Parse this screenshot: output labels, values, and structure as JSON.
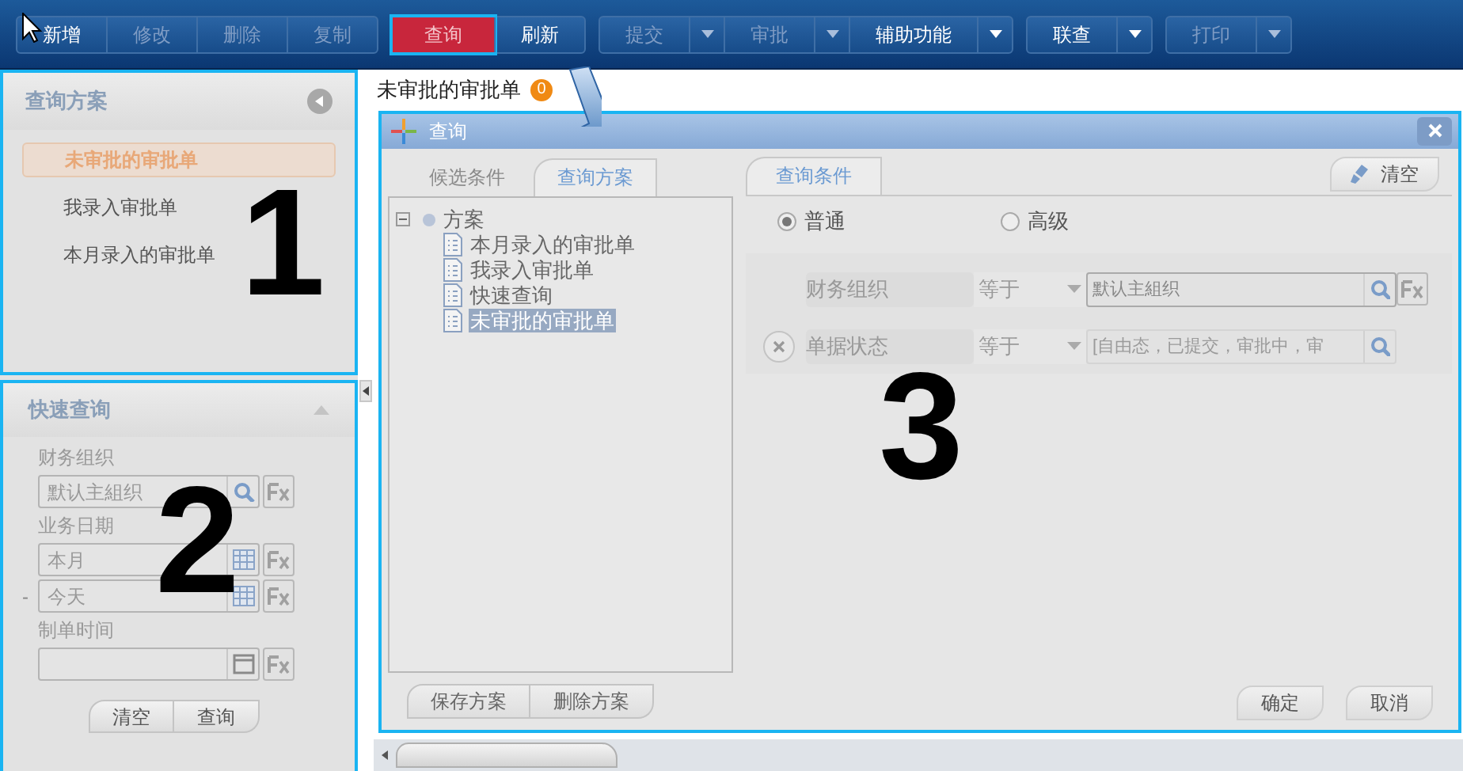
{
  "toolbar": {
    "groups": [
      {
        "buttons": [
          {
            "label": "新增",
            "enabled": true,
            "selected": false,
            "dropdown": false
          },
          {
            "label": "修改",
            "enabled": false,
            "selected": false,
            "dropdown": false
          },
          {
            "label": "删除",
            "enabled": false,
            "selected": false,
            "dropdown": false
          },
          {
            "label": "复制",
            "enabled": false,
            "selected": false,
            "dropdown": false
          }
        ]
      },
      {
        "buttons": [
          {
            "label": "查询",
            "enabled": true,
            "selected": true,
            "dropdown": false
          },
          {
            "label": "刷新",
            "enabled": true,
            "selected": false,
            "dropdown": false
          }
        ]
      },
      {
        "buttons": [
          {
            "label": "提交",
            "enabled": false,
            "selected": false,
            "dropdown": true
          },
          {
            "label": "审批",
            "enabled": false,
            "selected": false,
            "dropdown": true
          },
          {
            "label": "辅助功能",
            "enabled": true,
            "selected": false,
            "dropdown": true
          }
        ]
      },
      {
        "buttons": [
          {
            "label": "联查",
            "enabled": true,
            "selected": false,
            "dropdown": true
          }
        ]
      },
      {
        "buttons": [
          {
            "label": "打印",
            "enabled": false,
            "selected": false,
            "dropdown": true
          }
        ]
      }
    ]
  },
  "scheme_panel": {
    "title": "查询方案",
    "items": [
      {
        "label": "未审批的审批单",
        "selected": true
      },
      {
        "label": "我录入审批单",
        "selected": false
      },
      {
        "label": "本月录入的审批单",
        "selected": false
      }
    ]
  },
  "quick_query": {
    "title": "快速查询",
    "fields": [
      {
        "label": "财务组织",
        "value": "默认主組织",
        "kind": "search"
      },
      {
        "label": "业务日期",
        "value": "本月",
        "kind": "calendar"
      },
      {
        "prefix": "-",
        "value": "今天",
        "kind": "calendar"
      },
      {
        "label": "制单时间",
        "kind": "time"
      }
    ],
    "buttons": [
      "清空",
      "查询"
    ]
  },
  "document_tab": {
    "label": "未审批的审批单",
    "badge": "0"
  },
  "dialog": {
    "title": "查询",
    "left_tabs": [
      {
        "label": "候选条件",
        "selected": false
      },
      {
        "label": "查询方案",
        "selected": true
      }
    ],
    "tree": [
      {
        "label": "方案",
        "expanded": true,
        "selected": false,
        "children": [
          {
            "label": "本月录入的审批单",
            "selected": false
          },
          {
            "label": "我录入审批单",
            "selected": false
          },
          {
            "label": "快速查询",
            "selected": false
          },
          {
            "label": "未审批的审批单",
            "selected": true
          }
        ]
      }
    ],
    "left_buttons": [
      "保存方案",
      "删除方案"
    ],
    "right_tab": "查询条件",
    "clear_button": "清空",
    "modes": [
      {
        "label": "普通",
        "selected": true
      },
      {
        "label": "高级",
        "selected": false
      }
    ],
    "conditions": [
      {
        "field": "财务组织",
        "operator": "等于",
        "value": "默认主組织",
        "removable": false,
        "formula_button": true
      },
      {
        "field": "单据状态",
        "operator": "等于",
        "placeholder": "[自由态，已提交，审批中，审",
        "removable": true,
        "formula_button": false
      }
    ],
    "footer_buttons": [
      "确定",
      "取消"
    ]
  },
  "annotations": [
    {
      "label": "1"
    },
    {
      "label": "2"
    },
    {
      "label": "3"
    }
  ]
}
